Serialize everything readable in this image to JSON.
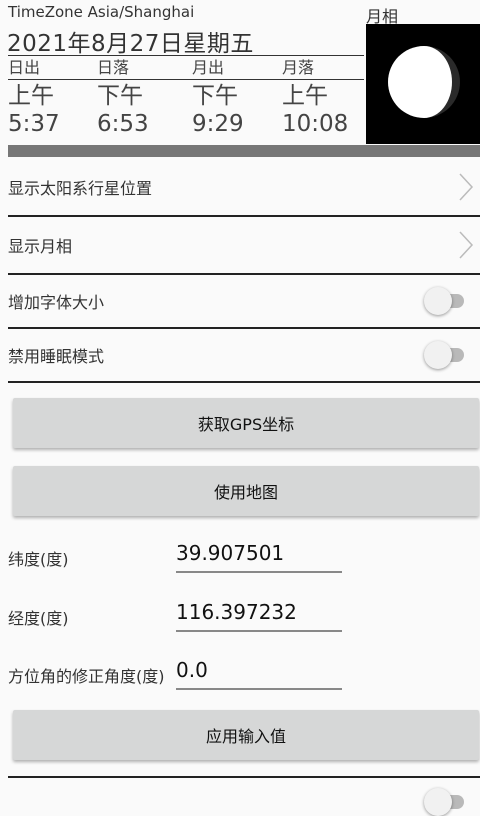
{
  "header": {
    "timezone": "TimeZone Asia/Shanghai",
    "date": "2021年8月27日星期五",
    "moon_label": "月相",
    "times": [
      {
        "label": "日出",
        "ampm": "上午",
        "time": "5:37"
      },
      {
        "label": "日落",
        "ampm": "下午",
        "time": "6:53"
      },
      {
        "label": "月出",
        "ampm": "下午",
        "time": "9:29"
      },
      {
        "label": "月落",
        "ampm": "上午",
        "time": "10:08"
      }
    ]
  },
  "settings": {
    "show_planets": "显示太阳系行星位置",
    "show_moon_phase": "显示月相",
    "increase_font": "增加字体大小",
    "disable_sleep": "禁用睡眠模式",
    "increase_font_on": false,
    "disable_sleep_on": false
  },
  "buttons": {
    "get_gps": "获取GPS坐标",
    "use_map": "使用地图",
    "apply_input": "应用输入值"
  },
  "fields": {
    "latitude_label": "纬度(度)",
    "latitude_value": "39.907501",
    "longitude_label": "经度(度)",
    "longitude_value": "116.397232",
    "azimuth_label": "方位角的修正角度(度)",
    "azimuth_value": "0.0"
  },
  "colors": {
    "moon_bg": "#000000",
    "moon_lit": "#ffffff",
    "button_bg": "#d6d7d7",
    "band": "#777777"
  }
}
